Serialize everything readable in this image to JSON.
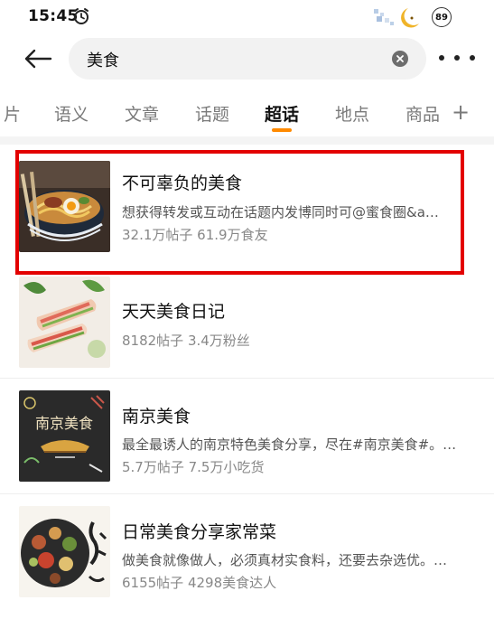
{
  "status_bar": {
    "time": "15:45",
    "battery": "89"
  },
  "search": {
    "query": "美食"
  },
  "icons": {
    "back": "back-arrow-icon",
    "clear": "clear-icon",
    "more": "more-icon",
    "alarm": "alarm-clock-icon"
  },
  "tabs": [
    {
      "label": "片"
    },
    {
      "label": "语义"
    },
    {
      "label": "文章"
    },
    {
      "label": "话题"
    },
    {
      "label": "超话"
    },
    {
      "label": "地点"
    },
    {
      "label": "商品"
    },
    {
      "label": "+"
    }
  ],
  "active_tab": "超话",
  "topics": [
    {
      "title": "不可辜负的美食",
      "description": "想获得转发或互动在话题内发博同时可@蜜食圈&a…",
      "stats": "32.1万帖子 61.9万食友"
    },
    {
      "title": "天天美食日记",
      "description": "",
      "stats": "8182帖子 3.4万粉丝"
    },
    {
      "title": "南京美食",
      "description": "最全最诱人的南京特色美食分享，尽在#南京美食#。…",
      "stats": "5.7万帖子 7.5万小吃货"
    },
    {
      "title": "日常美食分享家常菜",
      "description": "做美食就像做人，必须真材实食料，还要去杂选优。…",
      "stats": "6155帖子 4298美食达人"
    }
  ],
  "colors": {
    "highlight": "#e30000",
    "tab_indicator": "#ff8a00"
  }
}
